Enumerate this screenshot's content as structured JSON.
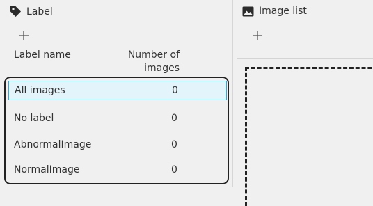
{
  "label_panel": {
    "title": "Label",
    "title_icon": "tag-icon",
    "add_label": "+",
    "col_name": "Label name",
    "col_count_line1": "Number of",
    "col_count_line2": "images",
    "rows": [
      {
        "name": "All images",
        "count": "0",
        "selected": true
      },
      {
        "name": "No label",
        "count": "0",
        "selected": false
      },
      {
        "name": "AbnormalImage",
        "count": "0",
        "selected": false
      },
      {
        "name": "NormalImage",
        "count": "0",
        "selected": false
      }
    ]
  },
  "image_panel": {
    "title": "Image list",
    "title_icon": "image-icon",
    "add_label": "+"
  },
  "colors": {
    "background": "#f0f0f0",
    "selection_bg": "#e3f4fb",
    "selection_border": "#3aa6d8",
    "text": "#333333"
  }
}
